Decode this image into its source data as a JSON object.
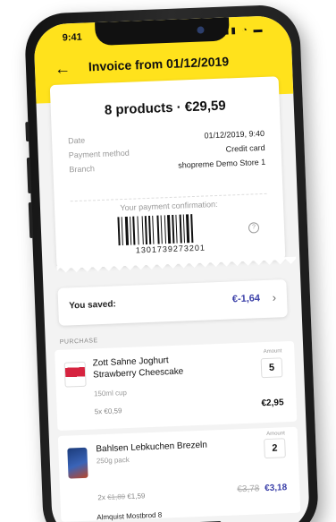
{
  "status": {
    "time": "9:41",
    "icons": "▮▮▮ ◔ ▬"
  },
  "header": {
    "title": "Invoice from 01/12/2019",
    "back_icon": "arrow-left-icon"
  },
  "invoice": {
    "summary": "8 products · €29,59",
    "date_label": "Date",
    "date_value": "01/12/2019, 9:40",
    "payment_label": "Payment method",
    "payment_value": "Credit card",
    "branch_label": "Branch",
    "branch_value": "shopreme Demo Store 1",
    "confirmation_label": "Your payment confirmation:",
    "barcode_number": "1301739273201",
    "help_icon": "?"
  },
  "savings": {
    "label": "You saved:",
    "value": "€-1,64",
    "chevron": "›"
  },
  "purchase": {
    "section_label": "PURCHASE",
    "items": [
      {
        "name": "Zott Sahne Joghurt Strawberry Cheescake",
        "size": "150ml cup",
        "amount_label": "Amount",
        "quantity": "5",
        "unit_prefix": "5x",
        "unit_price": "€0,59",
        "total": "€2,95"
      },
      {
        "name": "Bahlsen Lebkuchen Brezeln",
        "size": "250g pack",
        "amount_label": "Amount",
        "quantity": "2",
        "unit_prefix": "2x",
        "unit_old": "€1,89",
        "unit_price": "€1,59",
        "total_old": "€3,78",
        "total": "€3,18"
      }
    ],
    "peek_item": "Almquist Mostbrod 8"
  },
  "colors": {
    "accent": "#ffe21c",
    "saved": "#3a3fa8"
  }
}
